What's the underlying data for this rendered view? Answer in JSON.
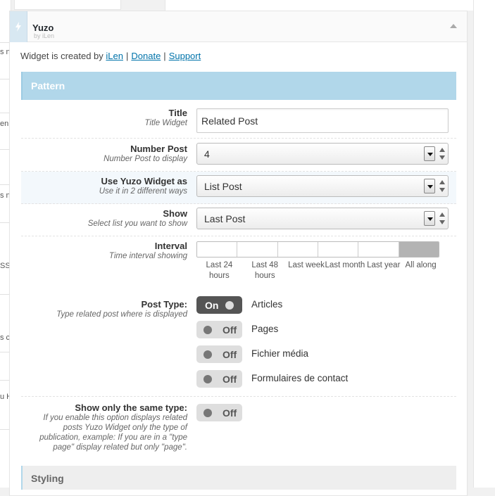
{
  "background": {
    "left_fragments": [
      "s n",
      "en",
      "s n",
      "SS",
      "s c",
      "u H"
    ]
  },
  "widget": {
    "title": "Yuzo",
    "subtitle": "by iLen",
    "credit": {
      "prefix": "Widget is created by",
      "author_link": "iLen",
      "donate_link": "Donate",
      "support_link": "Support",
      "separator": "|"
    },
    "sections": {
      "pattern": "Pattern",
      "styling": "Styling"
    },
    "fields": {
      "title": {
        "label": "Title",
        "desc": "Title Widget",
        "value": "Related Post"
      },
      "number_post": {
        "label": "Number Post",
        "desc": "Number Post to display",
        "value": "4"
      },
      "use_as": {
        "label": "Use Yuzo Widget as",
        "desc": "Use it in 2 different ways",
        "value": "List Post"
      },
      "show": {
        "label": "Show",
        "desc": "Select list you want to show",
        "value": "Last Post"
      },
      "interval": {
        "label": "Interval",
        "desc": "Time interval showing",
        "options": [
          "Last 24 hours",
          "Last 48 hours",
          "Last week",
          "Last month",
          "Last year",
          "All along"
        ],
        "selected": "All along"
      },
      "post_type": {
        "label": "Post Type:",
        "desc": "Type related post where is displayed",
        "items": [
          {
            "name": "Articles",
            "state": "On"
          },
          {
            "name": "Pages",
            "state": "Off"
          },
          {
            "name": "Fichier média",
            "state": "Off"
          },
          {
            "name": "Formulaires de contact",
            "state": "Off"
          }
        ]
      },
      "same_type": {
        "label": "Show only the same type:",
        "desc": "If you enable this option displays related posts Yuzo Widget only the type of publication, example: If you are in a \"type page\" display related but only \"page\".",
        "state": "Off"
      }
    }
  },
  "colors": {
    "section_bar": "#b1d7ea",
    "link": "#0073aa",
    "toggle_on": "#555555",
    "toggle_off": "#dedede"
  }
}
